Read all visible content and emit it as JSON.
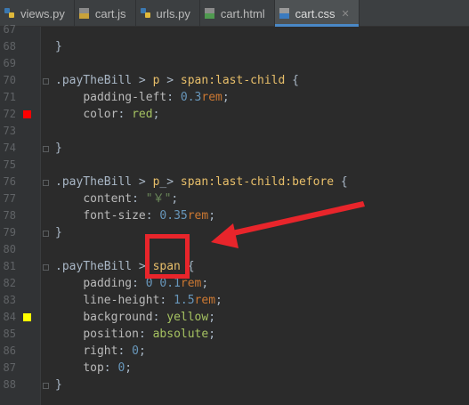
{
  "tabs": [
    {
      "label": "views.py",
      "icon": "python-file-icon",
      "active": false
    },
    {
      "label": "cart.js",
      "icon": "js-file-icon",
      "active": false
    },
    {
      "label": "urls.py",
      "icon": "python-file-icon",
      "active": false
    },
    {
      "label": "cart.html",
      "icon": "html-file-icon",
      "active": false
    },
    {
      "label": "cart.css",
      "icon": "css-file-icon",
      "active": true
    }
  ],
  "gutter": {
    "line_numbers": [
      "67",
      "68",
      "69",
      "70",
      "71",
      "72",
      "73",
      "74",
      "75",
      "76",
      "77",
      "78",
      "79",
      "80",
      "81",
      "82",
      "83",
      "84",
      "85",
      "86",
      "87",
      "88"
    ],
    "color_markers": [
      {
        "line": "72",
        "color": "#ff0000"
      },
      {
        "line": "84",
        "color": "#ffff00"
      }
    ]
  },
  "code_lines": [
    "",
    "}",
    "",
    ".payTheBill > p > span:last-child {",
    "    padding-left: 0.3rem;",
    "    color: red;",
    "",
    "}",
    "",
    ".payTheBill > p_> span:last-child:before {",
    "    content: \"￥\";",
    "    font-size: 0.35rem;",
    "}",
    "",
    ".payTheBill > span {",
    "    padding: 0 0.1rem;",
    "    line-height: 1.5rem;",
    "    background: yellow;",
    "    position: absolute;",
    "    right: 0;",
    "    top: 0;",
    "}"
  ],
  "annotation": {
    "color": "#e8252b"
  }
}
